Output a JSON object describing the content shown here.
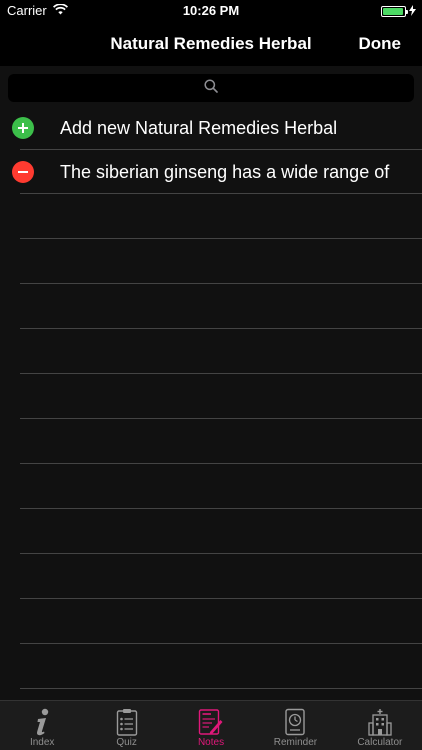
{
  "status_bar": {
    "carrier": "Carrier",
    "time": "10:26 PM",
    "battery_level": 0.95
  },
  "nav": {
    "title": "Natural Remedies Herbal",
    "done_label": "Done"
  },
  "search": {
    "icon": "search-icon"
  },
  "list": {
    "add_row": {
      "label": "Add new Natural Remedies Herbal",
      "icon": "add-icon",
      "icon_color": "#3cbf4a"
    },
    "items": [
      {
        "label": "The siberian ginseng has a wide range of",
        "icon": "delete-icon",
        "icon_color": "#ff3b30"
      }
    ]
  },
  "tabs": [
    {
      "label": "Index",
      "icon": "info-icon",
      "active": false
    },
    {
      "label": "Quiz",
      "icon": "checklist-icon",
      "active": false
    },
    {
      "label": "Notes",
      "icon": "notes-icon",
      "active": true
    },
    {
      "label": "Reminder",
      "icon": "clock-icon",
      "active": false
    },
    {
      "label": "Calculator",
      "icon": "hospital-icon",
      "active": false
    }
  ],
  "colors": {
    "accent": "#e0187a",
    "background": "#111111"
  }
}
